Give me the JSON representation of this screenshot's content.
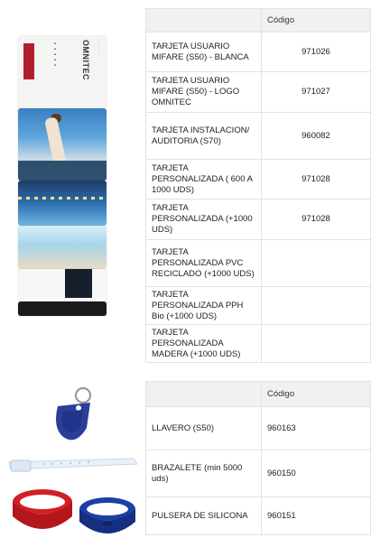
{
  "table1": {
    "header": [
      "",
      "Código"
    ],
    "rows": [
      {
        "desc": "TARJETA USUARIO MIFARE (S50) - BLANCA",
        "code": "971026"
      },
      {
        "desc": "TARJETA USUARIO MIFARE (S50) - LOGO OMNITEC",
        "code": "971027"
      },
      {
        "desc": "TARJETA INSTALACION/ AUDITORIA (S70)",
        "code": "960082"
      },
      {
        "desc": "TARJETA PERSONALIZADA ( 600 A 1000 UDS)",
        "code": "971028"
      },
      {
        "desc": "TARJETA PERSONALIZADA (+1000 UDS)",
        "code": "971028"
      },
      {
        "desc": "TARJETA PERSONALIZADA PVC RECICLADO (+1000 UDS)",
        "code": ""
      },
      {
        "desc": "TARJETA PERSONALIZADA PPH Bio (+1000 UDS)",
        "code": ""
      },
      {
        "desc": "TARJETA PERSONALIZADA MADERA (+1000 UDS)",
        "code": ""
      }
    ]
  },
  "table2": {
    "header": [
      "",
      "Código"
    ],
    "rows": [
      {
        "desc": "LLAVERO (S50)",
        "code": "960163"
      },
      {
        "desc": "BRAZALETE (min 5000 uds)",
        "code": "960150"
      },
      {
        "desc": "PULSERA DE SILICONA",
        "code": "960151"
      }
    ]
  },
  "cards_image": {
    "logo_text": "OMNITEC",
    "icons": [
      "card-stack-image",
      "keyfob-image",
      "bracelet-image",
      "silicone-wristband-image"
    ]
  },
  "colors": {
    "header_bg": "#f1f1f1",
    "border": "#e2e2e2",
    "keyfob_blue": "#2a3f9a",
    "wristband_red": "#d21f26",
    "wristband_blue": "#1d3fa6"
  }
}
